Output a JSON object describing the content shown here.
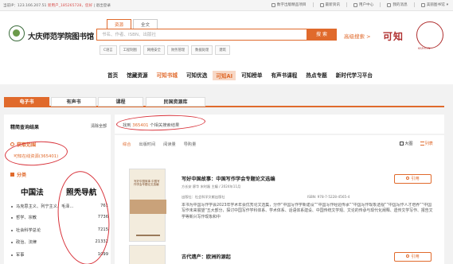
{
  "topbar": {
    "left_text": "当前IP：123.166.207.51",
    "left_highlight": "新用户_185265728，您好",
    "left_logout": "| 退出登录",
    "links": [
      "数字出版精品项目",
      "最新资讯",
      "用户中心",
      "我的消息",
      "美丽图书馆"
    ]
  },
  "header": {
    "library_name": "大庆师范学院图书馆",
    "search_tabs": [
      "资源",
      "全文"
    ],
    "search_placeholder": "书名、作者、ISBN、出版社",
    "search_button": "搜 索",
    "advanced_search": "高级搜索 >",
    "brand_logo": "可知",
    "brand_sub": "KEZHI.CN",
    "quick_tags": [
      "C语言",
      "工程制图",
      "网络安全",
      "财务管理",
      "数据处理",
      "建筑"
    ]
  },
  "mainnav": {
    "items": [
      "首页",
      "馆藏资源",
      "可知书城",
      "可知优选",
      "可知AI",
      "可知榜单",
      "有声书课程",
      "热点专题",
      "新时代学习平台"
    ]
  },
  "typetabs": [
    "电子书",
    "有声书",
    "课程",
    "民国资源库"
  ],
  "sidebar": {
    "title": "精简查询结果",
    "clear": "清除全部",
    "section1": "获取范围",
    "online_link": "可知在线资源(365401)",
    "section2": "分类",
    "cat_a": "中国法",
    "cat_b": "照秃导航",
    "rows": [
      {
        "label": "马克思主义、列宁主义、毛泽...",
        "count": "761"
      },
      {
        "label": "哲学、宗教",
        "count": "7736"
      },
      {
        "label": "社会科学总论",
        "count": "7215"
      },
      {
        "label": "政治、法律",
        "count": "21332"
      },
      {
        "label": "军事",
        "count": "1099"
      }
    ]
  },
  "results_bar": {
    "prefix": "找到",
    "count": "365401",
    "suffix": "个相关搜索结果"
  },
  "sort": {
    "options": [
      "综合",
      "出版时间",
      "阅读量",
      "导购量"
    ],
    "view_grid": "大图",
    "view_list": "列表"
  },
  "results": [
    {
      "title": "写好中国故事：中国写作学会专题论文选编",
      "meta": "方长安 廖华 宋时磊 主编 / 2024年11月",
      "publisher": "出版社：社会科学文献出版社",
      "isbn": "ISBN: 978-7-5228-4565-4",
      "desc": "本书为中国写作学会2023年学术年会优秀论文选集，分作“中国写作学新建设”“中国写作经验传承”“中国写作现象透视”“中国写作人才培养”“中国写作未来展望”五大部分，探讨中国写作学科体系、学术体系、话语体系建设、中国传统文学观、文论的传承与现代化阐释、遗传文学写作、报告文学等新兴写作现象和中",
      "cite": "引用",
      "cover_title": "写好中国故事 中国写作学会专题论文选编"
    },
    {
      "title": "古代遗产：欧洲的源起",
      "cite": "引用"
    }
  ],
  "colors": {
    "accent": "#e06a2c",
    "annotation": "#d8323a"
  }
}
